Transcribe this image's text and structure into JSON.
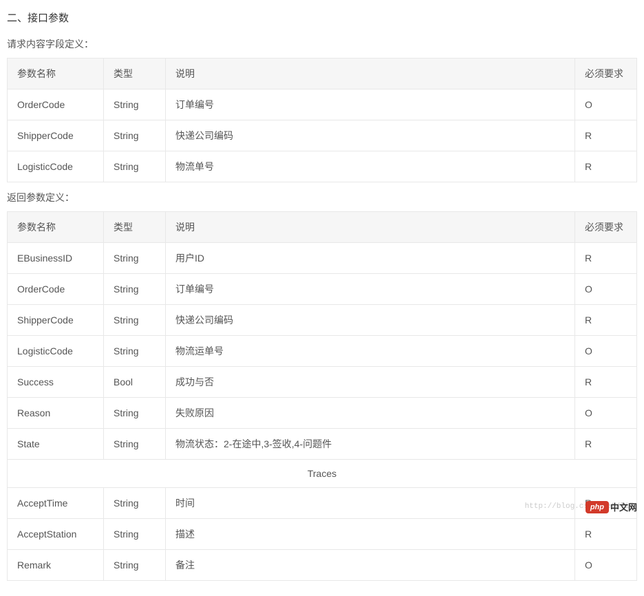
{
  "title": "二、接口参数",
  "request": {
    "subtitle": "请求内容字段定义：",
    "headers": {
      "name": "参数名称",
      "type": "类型",
      "desc": "说明",
      "req": "必须要求"
    },
    "rows": [
      {
        "name": "OrderCode",
        "type": "String",
        "desc": "订单编号",
        "req": "O"
      },
      {
        "name": "ShipperCode",
        "type": "String",
        "desc": "快递公司编码",
        "req": "R"
      },
      {
        "name": "LogisticCode",
        "type": "String",
        "desc": "物流单号",
        "req": "R"
      }
    ]
  },
  "response": {
    "subtitle": "返回参数定义：",
    "headers": {
      "name": "参数名称",
      "type": "类型",
      "desc": "说明",
      "req": "必须要求"
    },
    "rows_top": [
      {
        "name": "EBusinessID",
        "type": "String",
        "desc": "用户ID",
        "req": "R"
      },
      {
        "name": "OrderCode",
        "type": "String",
        "desc": "订单编号",
        "req": "O"
      },
      {
        "name": "ShipperCode",
        "type": "String",
        "desc": "快递公司编码",
        "req": "R"
      },
      {
        "name": "LogisticCode",
        "type": "String",
        "desc": "物流运单号",
        "req": "O"
      },
      {
        "name": "Success",
        "type": "Bool",
        "desc": "成功与否",
        "req": "R"
      },
      {
        "name": "Reason",
        "type": "String",
        "desc": "失败原因",
        "req": "O"
      },
      {
        "name": "State",
        "type": "String",
        "desc": "物流状态：2-在途中,3-签收,4-问题件",
        "req": "R"
      }
    ],
    "traces_label": "Traces",
    "rows_bottom": [
      {
        "name": "AcceptTime",
        "type": "String",
        "desc": "时间",
        "req": "R"
      },
      {
        "name": "AcceptStation",
        "type": "String",
        "desc": "描述",
        "req": "R"
      },
      {
        "name": "Remark",
        "type": "String",
        "desc": "备注",
        "req": "O"
      }
    ]
  },
  "watermark_text": "http://blog.csdn.net/li7",
  "logo": {
    "php": "php",
    "text": "中文网"
  }
}
